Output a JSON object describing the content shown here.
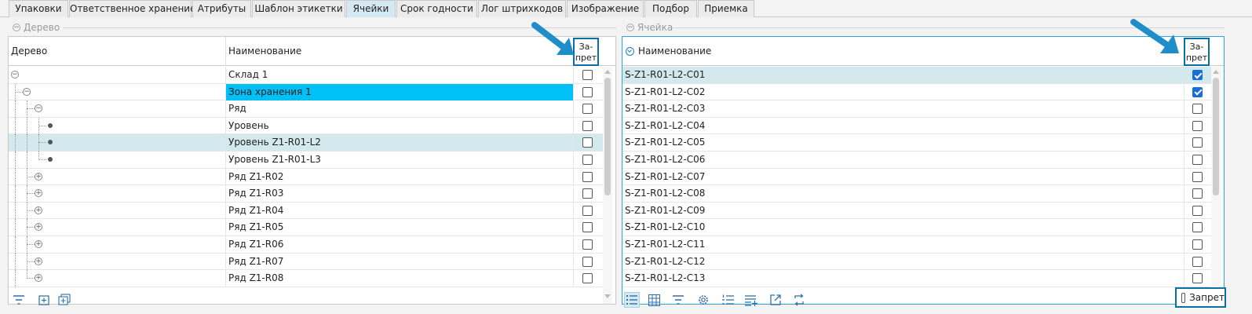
{
  "tabs": [
    {
      "label": "Упаковки",
      "active": false
    },
    {
      "label": "Ответственное хранение",
      "active": false
    },
    {
      "label": "Атрибуты",
      "active": false
    },
    {
      "label": "Шаблон этикетки",
      "active": false
    },
    {
      "label": "Ячейки",
      "active": true
    },
    {
      "label": "Срок годности",
      "active": false
    },
    {
      "label": "Лог штрихкодов",
      "active": false
    },
    {
      "label": "Изображение",
      "active": false
    },
    {
      "label": "Подбор",
      "active": false
    },
    {
      "label": "Приемка",
      "active": false
    }
  ],
  "left_panel": {
    "title": "Дерево",
    "columns": {
      "tree": "Дерево",
      "name": "Наименование",
      "ban_line1": "За-",
      "ban_line2": "прет"
    },
    "rows": [
      {
        "name": "Склад 1",
        "depth": 0,
        "node": "collapse",
        "ban": false,
        "selected": false,
        "highlight": false
      },
      {
        "name": "Зона хранения 1",
        "depth": 1,
        "node": "collapse",
        "ban": false,
        "selected": false,
        "highlight": true
      },
      {
        "name": "Ряд",
        "depth": 2,
        "node": "collapse",
        "ban": false,
        "selected": false,
        "highlight": false
      },
      {
        "name": "Уровень",
        "depth": 3,
        "node": "leaf",
        "ban": false,
        "selected": false,
        "highlight": false
      },
      {
        "name": "Уровень Z1-R01-L2",
        "depth": 3,
        "node": "leaf",
        "ban": false,
        "selected": true,
        "highlight": false
      },
      {
        "name": "Уровень Z1-R01-L3",
        "depth": 3,
        "node": "leaf",
        "ban": false,
        "selected": false,
        "highlight": false
      },
      {
        "name": "Ряд Z1-R02",
        "depth": 2,
        "node": "expand",
        "ban": false,
        "selected": false,
        "highlight": false
      },
      {
        "name": "Ряд Z1-R03",
        "depth": 2,
        "node": "expand",
        "ban": false,
        "selected": false,
        "highlight": false
      },
      {
        "name": "Ряд Z1-R04",
        "depth": 2,
        "node": "expand",
        "ban": false,
        "selected": false,
        "highlight": false
      },
      {
        "name": "Ряд Z1-R05",
        "depth": 2,
        "node": "expand",
        "ban": false,
        "selected": false,
        "highlight": false
      },
      {
        "name": "Ряд Z1-R06",
        "depth": 2,
        "node": "expand",
        "ban": false,
        "selected": false,
        "highlight": false
      },
      {
        "name": "Ряд Z1-R07",
        "depth": 2,
        "node": "expand",
        "ban": false,
        "selected": false,
        "highlight": false
      },
      {
        "name": "Ряд Z1-R08",
        "depth": 2,
        "node": "expand",
        "ban": false,
        "selected": false,
        "highlight": false
      }
    ],
    "toolbar_icons": [
      "filter-icon",
      "add-node-icon",
      "add-multiple-nodes-icon"
    ]
  },
  "right_panel": {
    "title": "Ячейка",
    "columns": {
      "name": "Наименование",
      "ban_line1": "За-",
      "ban_line2": "прет"
    },
    "rows": [
      {
        "name": "S-Z1-R01-L2-C01",
        "ban": true,
        "selected": true
      },
      {
        "name": "S-Z1-R01-L2-C02",
        "ban": true,
        "selected": false
      },
      {
        "name": "S-Z1-R01-L2-C03",
        "ban": false,
        "selected": false
      },
      {
        "name": "S-Z1-R01-L2-C04",
        "ban": false,
        "selected": false
      },
      {
        "name": "S-Z1-R01-L2-C05",
        "ban": false,
        "selected": false
      },
      {
        "name": "S-Z1-R01-L2-C06",
        "ban": false,
        "selected": false
      },
      {
        "name": "S-Z1-R01-L2-C07",
        "ban": false,
        "selected": false
      },
      {
        "name": "S-Z1-R01-L2-C08",
        "ban": false,
        "selected": false
      },
      {
        "name": "S-Z1-R01-L2-C09",
        "ban": false,
        "selected": false
      },
      {
        "name": "S-Z1-R01-L2-C10",
        "ban": false,
        "selected": false
      },
      {
        "name": "S-Z1-R01-L2-C11",
        "ban": false,
        "selected": false
      },
      {
        "name": "S-Z1-R01-L2-C12",
        "ban": false,
        "selected": false
      },
      {
        "name": "S-Z1-R01-L2-C13",
        "ban": false,
        "selected": false
      }
    ],
    "toolbar_icons": [
      "list-view-icon",
      "grid-view-icon",
      "filter-icon",
      "settings-icon",
      "numbered-list-icon",
      "add-rows-icon",
      "export-icon",
      "refresh-icon"
    ],
    "bottom_ban_label": "Запрет",
    "bottom_ban_checked": false
  },
  "colors": {
    "accent_arrow": "#1f8ec8",
    "callout_border": "#0b6fa6",
    "row_selected": "#d4e9ed",
    "cell_highlight": "#00c0f6",
    "checkbox_on": "#1a6fd6",
    "tab_active": "#d4e9f4"
  }
}
